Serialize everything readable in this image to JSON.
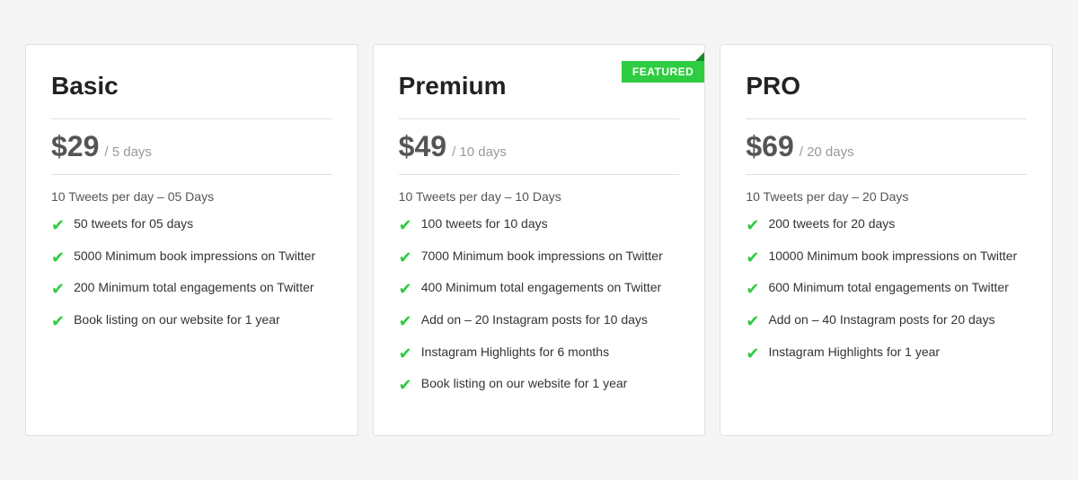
{
  "plans": [
    {
      "id": "basic",
      "name": "Basic",
      "featured": false,
      "price": "$29",
      "period": "/ 5 days",
      "subtitle": "10 Tweets per day – 05 Days",
      "features": [
        "50 tweets for 05 days",
        "5000 Minimum book impressions on Twitter",
        "200 Minimum total engagements on Twitter",
        "Book listing on our website for 1 year"
      ]
    },
    {
      "id": "premium",
      "name": "Premium",
      "featured": true,
      "featured_label": "FEATURED",
      "price": "$49",
      "period": "/ 10 days",
      "subtitle": "10 Tweets per day – 10 Days",
      "features": [
        "100 tweets for 10 days",
        "7000 Minimum book impressions on Twitter",
        "400 Minimum total engagements on Twitter",
        "Add on – 20 Instagram posts for 10 days",
        "Instagram Highlights for 6 months",
        "Book listing on our website for 1 year"
      ]
    },
    {
      "id": "pro",
      "name": "PRO",
      "featured": false,
      "price": "$69",
      "period": "/ 20 days",
      "subtitle": "10 Tweets per day – 20 Days",
      "features": [
        "200 tweets for 20 days",
        "10000 Minimum book impressions on Twitter",
        "600 Minimum total engagements on Twitter",
        "Add on – 40 Instagram posts for 20 days",
        "Instagram Highlights for 1 year"
      ]
    }
  ],
  "check_symbol": "✔"
}
